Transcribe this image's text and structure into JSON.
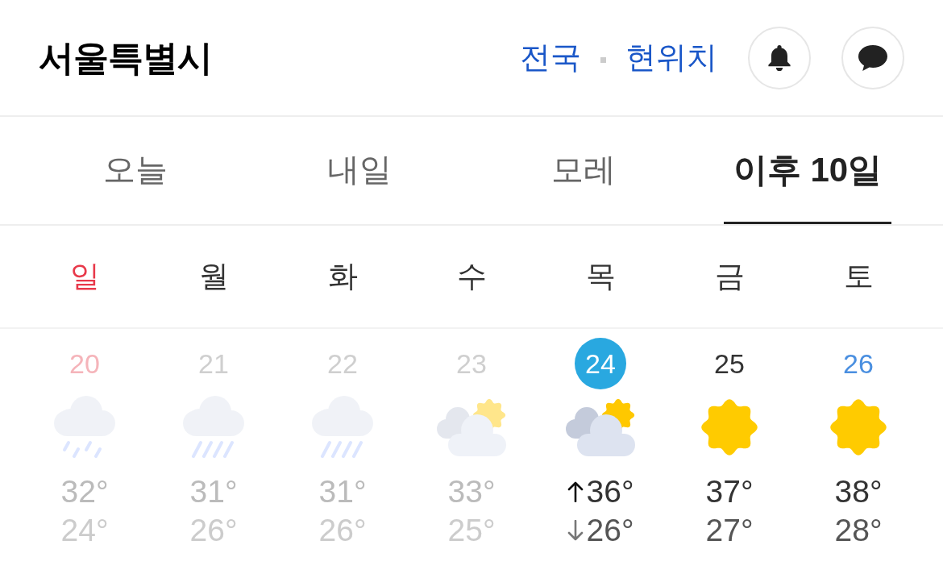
{
  "header": {
    "title": "서울특별시",
    "links": [
      "전국",
      "현위치"
    ]
  },
  "tabs": [
    {
      "label": "오늘",
      "selected": false
    },
    {
      "label": "내일",
      "selected": false
    },
    {
      "label": "모레",
      "selected": false
    },
    {
      "label": "이후 10일",
      "selected": true
    }
  ],
  "weekdays": [
    {
      "label": "일",
      "kind": "sunday"
    },
    {
      "label": "월",
      "kind": "plain"
    },
    {
      "label": "화",
      "kind": "plain"
    },
    {
      "label": "수",
      "kind": "plain"
    },
    {
      "label": "목",
      "kind": "plain"
    },
    {
      "label": "금",
      "kind": "plain"
    },
    {
      "label": "토",
      "kind": "plain"
    }
  ],
  "days": [
    {
      "date": "20",
      "kind": "sunday",
      "past": true,
      "selected": false,
      "weather": {
        "kind": "light_rain"
      },
      "high": "32°",
      "low": "24°"
    },
    {
      "date": "21",
      "kind": "weekday",
      "past": true,
      "selected": false,
      "weather": {
        "kind": "rain"
      },
      "high": "31°",
      "low": "26°"
    },
    {
      "date": "22",
      "kind": "weekday",
      "past": true,
      "selected": false,
      "weather": {
        "kind": "rain"
      },
      "high": "31°",
      "low": "26°"
    },
    {
      "date": "23",
      "kind": "weekday",
      "past": true,
      "selected": false,
      "weather": {
        "kind": "partly_cloudy"
      },
      "high": "33°",
      "low": "25°"
    },
    {
      "date": "24",
      "kind": "weekday",
      "past": false,
      "selected": true,
      "weather": {
        "kind": "partly_cloudy"
      },
      "high": "36°",
      "low": "26°"
    },
    {
      "date": "25",
      "kind": "weekday",
      "past": false,
      "selected": false,
      "weather": {
        "kind": "sunny"
      },
      "high": "37°",
      "low": "27°"
    },
    {
      "date": "26",
      "kind": "saturday",
      "past": false,
      "selected": false,
      "weather": {
        "kind": "sunny"
      },
      "high": "38°",
      "low": "28°"
    }
  ]
}
